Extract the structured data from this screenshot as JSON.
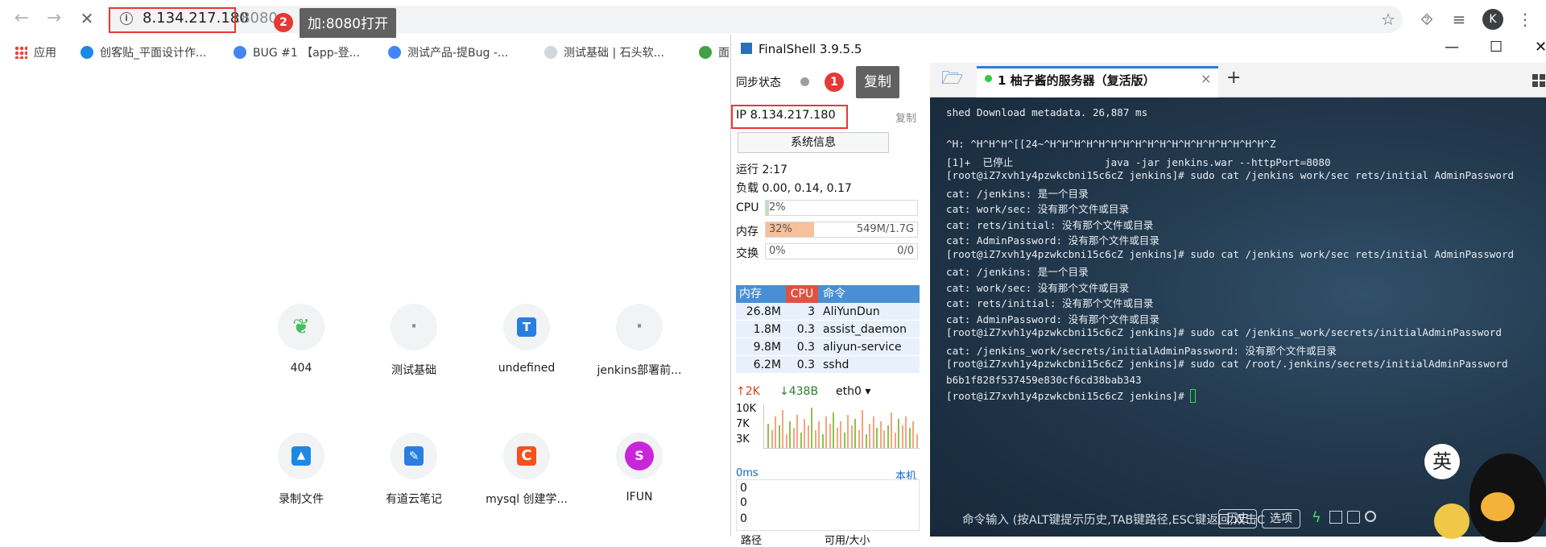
{
  "browser": {
    "url_host": "8.134.217.180",
    "url_port": ":8080",
    "back_icon": "←",
    "forward_icon": "→",
    "reload_icon": "✕",
    "info_icon": "i",
    "star_icon": "☆",
    "extensions_icon": "⯑",
    "queue_icon": "≡",
    "menu_icon": "⋮",
    "avatar_letter": "K"
  },
  "annotations": {
    "badge1": "1",
    "badge2": "2",
    "tooltip_copy": "复制",
    "tooltip_port": "加:8080打开"
  },
  "bookmarks": [
    {
      "label": "应用",
      "color": "#e8453c"
    },
    {
      "label": "创客贴_平面设计作...",
      "color": "#1e88e5"
    },
    {
      "label": "BUG #1 【app-登...",
      "color": "#4285f4"
    },
    {
      "label": "测试产品-提Bug -...",
      "color": "#4285f4"
    },
    {
      "label": "测试基础 | 石头软...",
      "color": "#90a4ae"
    },
    {
      "label": "面",
      "color": "#43a047"
    }
  ],
  "shortcuts": [
    {
      "label": "404",
      "glyph": "❦",
      "color": "#43c15b"
    },
    {
      "label": "测试基础",
      "glyph": "·",
      "color": "#90a4ae"
    },
    {
      "label": "undefined",
      "glyph": "T",
      "color": "#2a7de1"
    },
    {
      "label": "jenkins部署前...",
      "glyph": "·",
      "color": "#90a4ae"
    },
    {
      "label": "录制文件",
      "glyph": "▲",
      "color": "#1e88e5"
    },
    {
      "label": "有道云笔记",
      "glyph": "✎",
      "color": "#2a7de1"
    },
    {
      "label": "mysql 创建学...",
      "glyph": "C",
      "color": "#f4511e"
    },
    {
      "label": "IFUN",
      "glyph": "S",
      "color": "#c926d9"
    }
  ],
  "finalshell": {
    "title": "FinalShell 3.9.5.5",
    "win_min": "—",
    "win_max": "☐",
    "win_close": "✕",
    "sync_label": "同步状态",
    "ip_text": "IP 8.134.217.180",
    "copy_label": "复制",
    "sysinfo_button": "系统信息",
    "uptime": "运行 2:17",
    "load": "负载 0.00, 0.14, 0.17",
    "cpu_label": "CPU",
    "cpu_value": "2%",
    "cpu_percent": 2,
    "mem_label": "内存",
    "mem_percent_text": "32%",
    "mem_percent": 32,
    "mem_value": "549M/1.7G",
    "swap_label": "交换",
    "swap_percent_text": "0%",
    "swap_value": "0/0",
    "proc_headers": {
      "mem": "内存",
      "cpu": "CPU",
      "cmd": "命令"
    },
    "processes": [
      {
        "mem": "26.8M",
        "cpu": "3",
        "cmd": "AliYunDun"
      },
      {
        "mem": "1.8M",
        "cpu": "0.3",
        "cmd": "assist_daemon"
      },
      {
        "mem": "9.8M",
        "cpu": "0.3",
        "cmd": "aliyun-service"
      },
      {
        "mem": "6.2M",
        "cpu": "0.3",
        "cmd": "sshd"
      }
    ],
    "net_up": "↑2K",
    "net_down": "↓438B",
    "net_iface": "eth0",
    "net_scale": [
      "10K",
      "7K",
      "3K"
    ],
    "net_bars": [
      0.55,
      0.4,
      0.7,
      0.5,
      0.85,
      0.3,
      0.6,
      0.45,
      0.75,
      0.35,
      0.65,
      0.5,
      0.9,
      0.4,
      0.6,
      0.3,
      0.7,
      0.55,
      0.8,
      0.45,
      0.6,
      0.35,
      0.75,
      0.5,
      0.65,
      0.4,
      0.85,
      0.3,
      0.55,
      0.7,
      0.45,
      0.6,
      0.4,
      0.5,
      0.8,
      0.35,
      0.65,
      0.5,
      0.7,
      0.45,
      0.6,
      0.3
    ],
    "ping_label": "0ms",
    "ping_host": "本机",
    "ping_values": [
      "0",
      "0",
      "0"
    ],
    "bottom_headers": {
      "path": "路径",
      "avail": "可用/大小"
    },
    "tab_label": "1 柚子酱的服务器（复活版）",
    "folder_icon": "folder-icon",
    "tab_close": "×",
    "tab_add": "+",
    "terminal_lines": [
      "shed Download metadata. 26,887 ms",
      "",
      "^H: ^H^H^H^[[24~^H^H^H^H^H^H^H^H^H^H^H^H^H^H^H^H^H^H^Z",
      "[1]+  已停止               java -jar jenkins.war --httpPort=8080",
      "[root@iZ7xvh1y4pzwkcbni15c6cZ jenkins]# sudo cat /jenkins work/sec rets/initial AdminPassword",
      "cat: /jenkins: 是一个目录",
      "cat: work/sec: 没有那个文件或目录",
      "cat: rets/initial: 没有那个文件或目录",
      "cat: AdminPassword: 没有那个文件或目录",
      "[root@iZ7xvh1y4pzwkcbni15c6cZ jenkins]# sudo cat /jenkins work/sec rets/initial AdminPassword",
      "cat: /jenkins: 是一个目录",
      "cat: work/sec: 没有那个文件或目录",
      "cat: rets/initial: 没有那个文件或目录",
      "cat: AdminPassword: 没有那个文件或目录",
      "[root@iZ7xvh1y4pzwkcbni15c6cZ jenkins]# sudo cat /jenkins_work/secrets/initialAdminPassword",
      "cat: /jenkins_work/secrets/initialAdminPassword: 没有那个文件或目录",
      "[root@iZ7xvh1y4pzwkcbni15c6cZ jenkins]# sudo cat /root/.jenkins/secrets/initialAdminPassword",
      "b6b1f828f537459e830cf6cd38bab343",
      "[root@iZ7xvh1y4pzwkcbni15c6cZ jenkins]# "
    ],
    "cmd_placeholder": "命令输入 (按ALT键提示历史,TAB键路径,ESC键返回,双击C",
    "history_button": "历史",
    "options_button": "选项",
    "mascot_text": "英"
  }
}
